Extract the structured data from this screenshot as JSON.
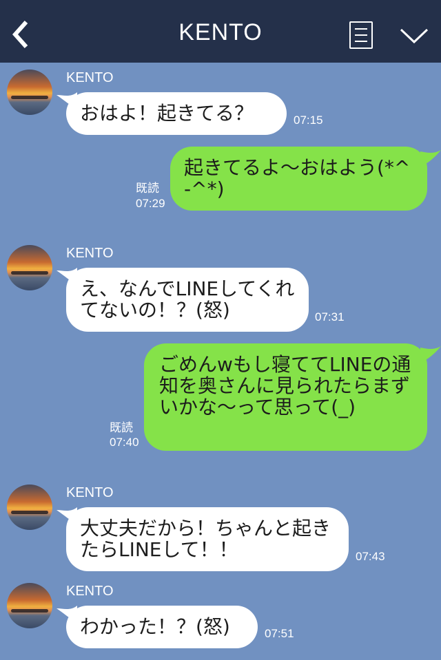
{
  "header": {
    "title": "KENTO",
    "back_icon": "chevron-left-icon",
    "menu_icon": "notes-icon",
    "more_icon": "chevron-down-icon"
  },
  "colors": {
    "background": "#7191c1",
    "header": "#24304a",
    "incoming": "#ffffff",
    "outgoing": "#85e249"
  },
  "messages": [
    {
      "type": "incoming",
      "sender": "KENTO",
      "text": "おはよ！起きてる？",
      "time": "07:15"
    },
    {
      "type": "outgoing",
      "text": "起きてるよ〜おはよう(*^-^*)",
      "read": "既読",
      "time": "07:29"
    },
    {
      "type": "incoming",
      "sender": "KENTO",
      "text": "え、なんでLINEしてくれてないの！？(怒)",
      "time": "07:31"
    },
    {
      "type": "outgoing",
      "text": "ごめんwもし寝ててLINEの通知を奥さんに見られたらまずいかな〜って思って(_)",
      "read": "既読",
      "time": "07:40"
    },
    {
      "type": "incoming",
      "sender": "KENTO",
      "text": "大丈夫だから！ちゃんと起きたらLINEして！！",
      "time": "07:43"
    },
    {
      "type": "incoming",
      "sender": "KENTO",
      "text": "わかった！？(怒)",
      "time": "07:51"
    }
  ]
}
